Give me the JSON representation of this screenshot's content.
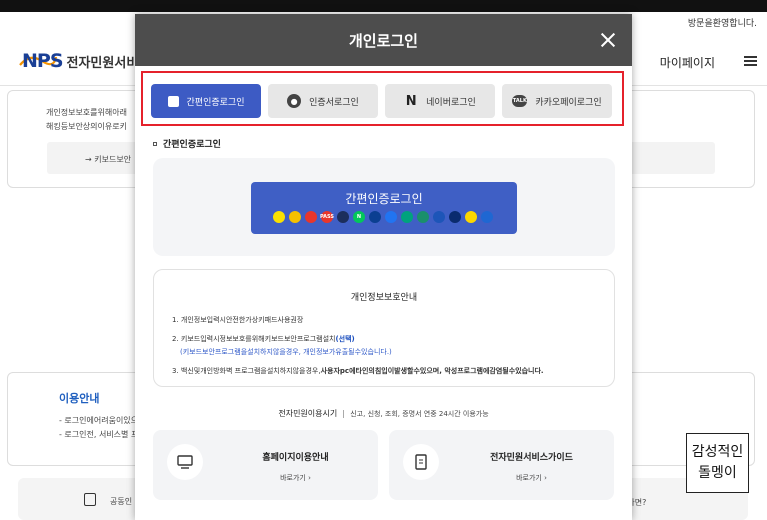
{
  "top_bar": {
    "welcome_text": "방문을환영합니다."
  },
  "header": {
    "logo_mark": "NPS",
    "service_name": "전자민원서비스",
    "mypage_label": "마이페이지"
  },
  "background": {
    "notice_line1": "개인정보보호를위해아래",
    "notice_line2": "해킹등보안상의이유로키",
    "keyboard_security_link": "→ 키보드보안",
    "info_title": "이용안내",
    "info_line1": "- 로그인에어려움이있으",
    "info_line2": "- 로그인전, 서비스별 프",
    "bottom_text": "공동인",
    "bottom_right_text": "았다면?"
  },
  "modal": {
    "title": "개인로그인",
    "tabs": [
      {
        "label": "간편인증로그인",
        "icon": "lock-icon",
        "active": true
      },
      {
        "label": "인증서로그인",
        "icon": "certificate-icon",
        "active": false
      },
      {
        "label": "네이버로그인",
        "icon": "naver-icon",
        "active": false
      },
      {
        "label": "카카오페이로그인",
        "icon": "kakao-talk-icon",
        "active": false
      }
    ],
    "section_label": "간편인증로그인",
    "simple_auth_button": "간편인증로그인",
    "providers": [
      {
        "name": "kakao",
        "glyph": "",
        "color": "#fae100",
        "fg": "#3c1e1e"
      },
      {
        "name": "payco",
        "glyph": "",
        "color": "#f5c000",
        "fg": "#333"
      },
      {
        "name": "samsung-pass",
        "glyph": "",
        "color": "#e8362b",
        "fg": "#fff"
      },
      {
        "name": "pass",
        "glyph": "PASS",
        "color": "#e8362b",
        "fg": "#fff"
      },
      {
        "name": "kb",
        "glyph": "",
        "color": "#1c2e5c",
        "fg": "#fff"
      },
      {
        "name": "naver",
        "glyph": "N",
        "color": "#03c75a",
        "fg": "#fff"
      },
      {
        "name": "shinhan",
        "glyph": "",
        "color": "#0b3f91",
        "fg": "#fff"
      },
      {
        "name": "toss",
        "glyph": "",
        "color": "#2174f1",
        "fg": "#fff"
      },
      {
        "name": "hana",
        "glyph": "",
        "color": "#00a37d",
        "fg": "#fff"
      },
      {
        "name": "nh",
        "glyph": "",
        "color": "#1a8f6b",
        "fg": "#fff"
      },
      {
        "name": "woori",
        "glyph": "",
        "color": "#1d55b8",
        "fg": "#fff"
      },
      {
        "name": "banksalad",
        "glyph": "",
        "color": "#0a2b6e",
        "fg": "#fff"
      },
      {
        "name": "kakaobank",
        "glyph": "",
        "color": "#fcd700",
        "fg": "#333"
      },
      {
        "name": "ibk",
        "glyph": "",
        "color": "#1f67d2",
        "fg": "#fff"
      }
    ],
    "privacy": {
      "title": "개인정보보호안내",
      "item1": "1. 개인정보입력시안전한가상키패드사용권장",
      "item2_prefix": "2. 키보드입력시정보보호를위해키보드보안프로그램설치",
      "item2_emph": "(선택)",
      "item2_sub": "(키보드보안프로그램을설치하지않을경우, 개인정보가유출될수있습니다.)",
      "item3_prefix": "3. 백신및개인방화벽 프로그램을설치하지않을경우,",
      "item3_emph": "사용자pc에타인의침입이발생할수있으며, 악성프로그램에감염될수있습니다."
    },
    "hours_label": "전자민원이용시기",
    "hours_note": "신고, 신청, 조회, 증명서 연중 24시간 이용가능",
    "guides": [
      {
        "title": "홈페이지이용안내",
        "link": "바로가기  ›"
      },
      {
        "title": "전자민원서비스가이드",
        "link": "바로가기  ›"
      }
    ]
  },
  "watermark": {
    "line1": "감성적인",
    "line2": "돌멩이"
  }
}
